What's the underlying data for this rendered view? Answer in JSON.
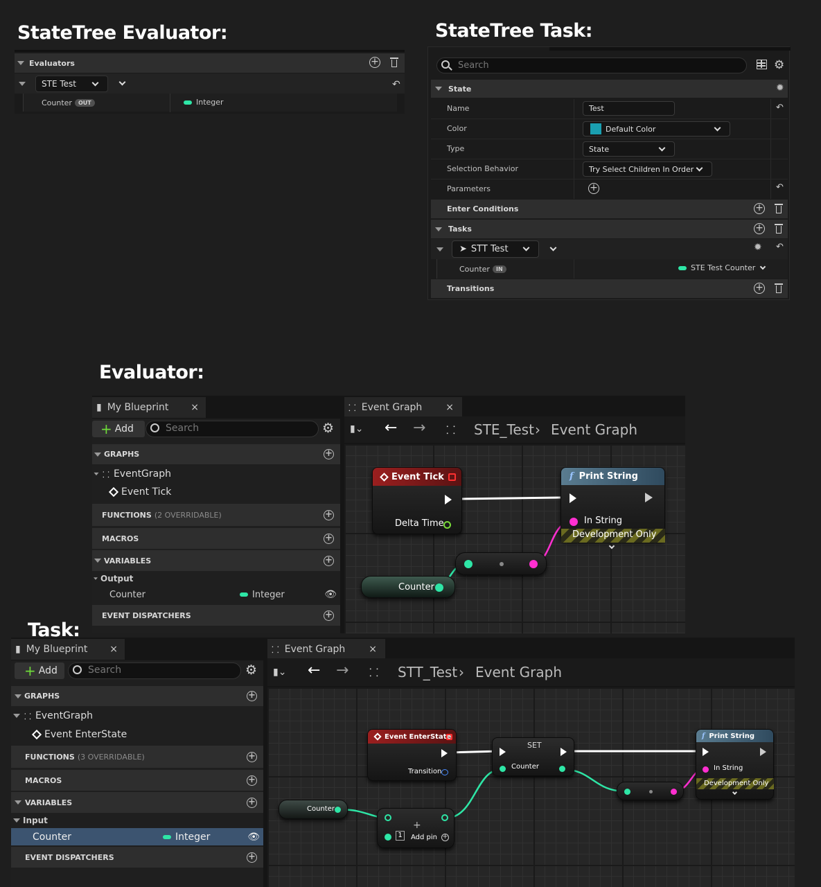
{
  "titles": {
    "evaluator": "StateTree Evaluator:",
    "task": "StateTree Task:",
    "evaluator_bp": "Evaluator:",
    "task_bp": "Task:"
  },
  "ste": {
    "section": "Evaluators",
    "item": "STE Test",
    "prop": "Counter",
    "prop_tag": "OUT",
    "prop_type": "Integer"
  },
  "stt": {
    "search_placeholder": "Search",
    "state_section": "State",
    "rows": {
      "name": "Name",
      "name_value": "Test",
      "color": "Color",
      "color_value": "Default Color",
      "type": "Type",
      "type_value": "State",
      "selection": "Selection Behavior",
      "selection_value": "Try Select Children In Order",
      "params": "Parameters"
    },
    "enter_conditions": "Enter Conditions",
    "tasks": "Tasks",
    "task_item": "STT Test",
    "task_prop": "Counter",
    "task_prop_tag": "IN",
    "task_prop_value": "STE Test Counter",
    "transitions": "Transitions"
  },
  "eval_bp": {
    "tab_left": "My Blueprint",
    "tab_graph": "Event Graph",
    "add": "Add",
    "search": "Search",
    "crumb_asset": "STE_Test",
    "crumb_graph": "Event Graph",
    "graphs": "GRAPHS",
    "event_graph": "EventGraph",
    "event": "Event Tick",
    "functions": "FUNCTIONS",
    "functions_sub": "(2 OVERRIDABLE)",
    "macros": "MACROS",
    "variables": "VARIABLES",
    "var_group": "Output",
    "var_name": "Counter",
    "var_type": "Integer",
    "dispatchers": "EVENT DISPATCHERS",
    "nodes": {
      "tick": "Event Tick",
      "delta": "Delta Time",
      "print": "Print String",
      "in_string": "In String",
      "dev": "Development Only",
      "counter": "Counter"
    }
  },
  "task_bp": {
    "tab_left": "My Blueprint",
    "tab_graph": "Event Graph",
    "add": "Add",
    "search": "Search",
    "crumb_asset": "STT_Test",
    "crumb_graph": "Event Graph",
    "graphs": "GRAPHS",
    "event_graph": "EventGraph",
    "event": "Event EnterState",
    "functions": "FUNCTIONS",
    "functions_sub": "(3 OVERRIDABLE)",
    "macros": "MACROS",
    "variables": "VARIABLES",
    "var_group": "Input",
    "var_name": "Counter",
    "var_type": "Integer",
    "dispatchers": "EVENT DISPATCHERS",
    "nodes": {
      "enter": "Event EnterState",
      "transition": "Transition",
      "set": "SET",
      "set_counter": "Counter",
      "print": "Print String",
      "in_string": "In String",
      "dev": "Development Only",
      "counter": "Counter",
      "add_pin": "Add pin",
      "one": "1"
    }
  },
  "colors": {
    "integer": "#2ee6a6",
    "string": "#ff2fd0",
    "event_red": "#8a1c1c",
    "function_blue": "#4a6a80"
  }
}
